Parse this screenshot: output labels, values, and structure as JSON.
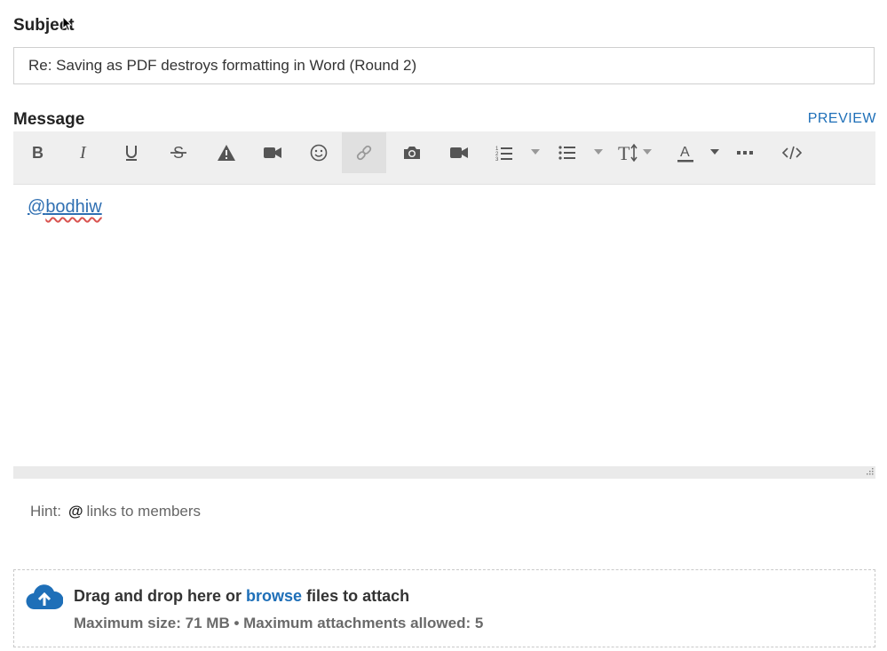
{
  "subject": {
    "label": "Subject",
    "value": "Re: Saving as PDF destroys formatting in Word (Round 2)"
  },
  "message": {
    "label": "Message",
    "preview_label": "PREVIEW",
    "body_mention_at": "@",
    "body_mention_name": "bodhiw"
  },
  "toolbar": {
    "items": [
      {
        "name": "bold",
        "icon": "bold-icon",
        "glyph": "B"
      },
      {
        "name": "italic",
        "icon": "italic-icon",
        "glyph": "I"
      },
      {
        "name": "underline",
        "icon": "underline-icon",
        "glyph": "U"
      },
      {
        "name": "strikethrough",
        "icon": "strikethrough-icon",
        "glyph": "S"
      },
      {
        "name": "spoiler",
        "icon": "warning-icon"
      },
      {
        "name": "video",
        "icon": "video-camera-icon"
      },
      {
        "name": "emoji",
        "icon": "emoji-icon"
      },
      {
        "name": "link",
        "icon": "link-icon"
      },
      {
        "name": "photo",
        "icon": "camera-icon"
      },
      {
        "name": "insert-video",
        "icon": "video-camera-icon"
      },
      {
        "name": "numbered-list",
        "icon": "numbered-list-icon"
      },
      {
        "name": "bulleted-list",
        "icon": "bulleted-list-icon"
      },
      {
        "name": "text-size",
        "icon": "text-size-icon"
      },
      {
        "name": "text-color",
        "icon": "text-color-icon",
        "glyph": "A"
      },
      {
        "name": "more",
        "icon": "more-icon"
      },
      {
        "name": "source",
        "icon": "code-icon"
      }
    ]
  },
  "hint": {
    "label": "Hint:",
    "symbol": "@",
    "text": "links to members"
  },
  "attachments": {
    "text_before": "Drag and drop here or ",
    "browse_label": "browse",
    "text_after": " files to attach",
    "limits": "Maximum size: 71 MB • Maximum attachments allowed: 5"
  },
  "colors": {
    "accent": "#1e6fb8",
    "toolbar_bg": "#efefef"
  }
}
